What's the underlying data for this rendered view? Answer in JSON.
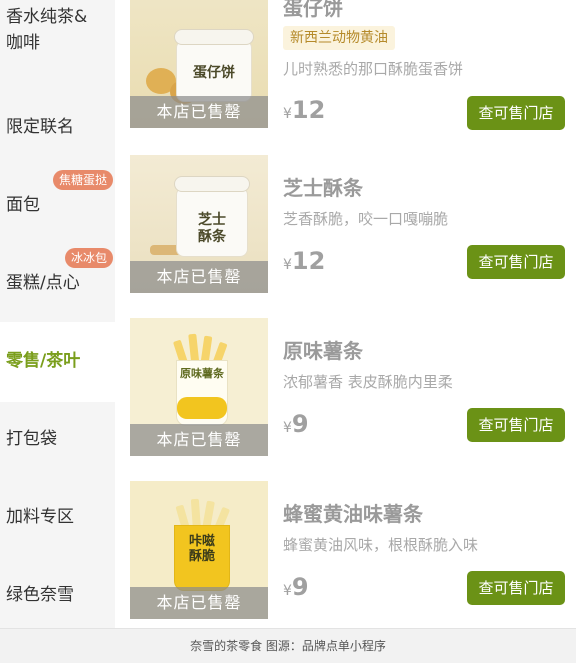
{
  "sidebar": {
    "items": [
      {
        "label": "香水纯茶&\n咖啡",
        "badge": "",
        "active": false
      },
      {
        "label": "限定联名",
        "badge": "",
        "active": false
      },
      {
        "label": "面包",
        "badge": "焦糖蛋挞",
        "active": false
      },
      {
        "label": "蛋糕/点心",
        "badge": "冰冰包",
        "active": false
      },
      {
        "label": "零售/茶叶",
        "badge": "",
        "active": true
      },
      {
        "label": "打包袋",
        "badge": "",
        "active": false
      },
      {
        "label": "加料专区",
        "badge": "",
        "active": false
      },
      {
        "label": "绿色奈雪",
        "badge": "",
        "active": false
      }
    ]
  },
  "products": [
    {
      "name": "蛋仔饼",
      "tag": "新西兰动物黄油",
      "desc": "儿时熟悉的那口酥脆蛋香饼",
      "currency": "¥",
      "price": "12",
      "sold_out": "本店已售罄",
      "button": "查可售门店",
      "pack_label": "蛋仔饼"
    },
    {
      "name": "芝士酥条",
      "tag": "",
      "desc": "芝香酥脆，咬一口嘎嘣脆",
      "currency": "¥",
      "price": "12",
      "sold_out": "本店已售罄",
      "button": "查可售门店",
      "pack_label": "芝士\n酥条"
    },
    {
      "name": "原味薯条",
      "tag": "",
      "desc": "浓郁薯香 表皮酥脆内里柔",
      "currency": "¥",
      "price": "9",
      "sold_out": "本店已售罄",
      "button": "查可售门店",
      "pack_label": "原味薯条"
    },
    {
      "name": "蜂蜜黄油味薯条",
      "tag": "",
      "desc": "蜂蜜黄油风味，根根酥脆入味",
      "currency": "¥",
      "price": "9",
      "sold_out": "本店已售罄",
      "button": "查可售门店",
      "pack_label": "咔嗞\n酥脆"
    }
  ],
  "caption": "奈雪的茶零食 图源：品牌点单小程序",
  "colors": {
    "accent": "#6b9216",
    "active_text": "#7a9e1b",
    "badge": "#e88a6a"
  }
}
